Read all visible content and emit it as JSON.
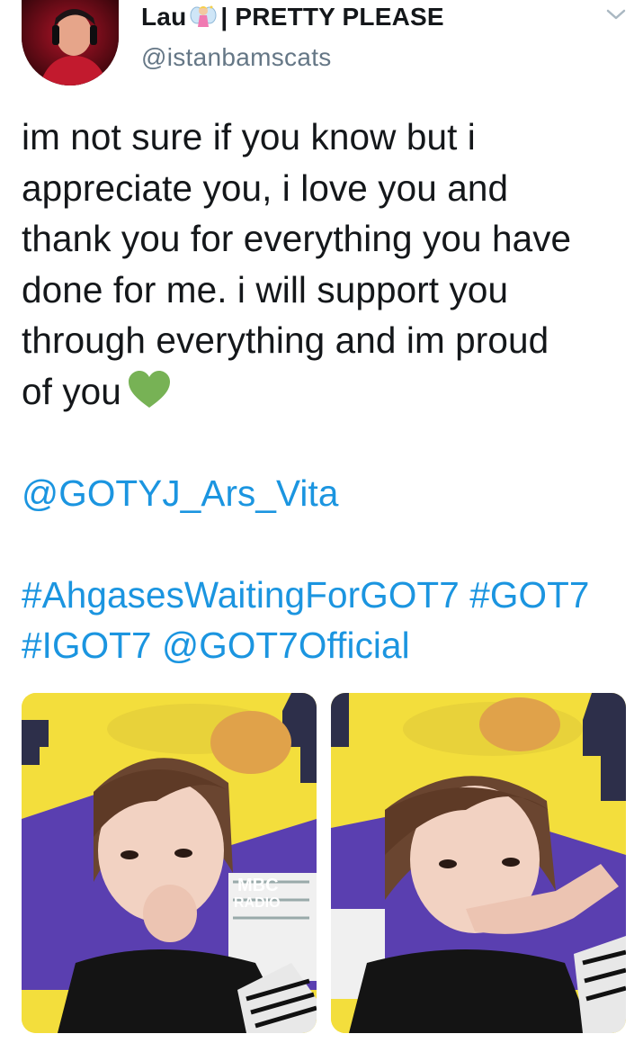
{
  "user": {
    "display_name_prefix": "Lau",
    "display_name_suffix": "| PRETTY PLEASE",
    "handle": "@istanbamscats"
  },
  "tweet": {
    "lines": [
      "im not sure if you know but i",
      "appreciate you, i love you and",
      "thank you for everything you have",
      "done for me. i will support you",
      "through everything and im proud",
      "of you"
    ],
    "mention_line": "@GOTYJ_Ars_Vita",
    "hashtags_line1": "#AhgasesWaitingForGOT7 #GOT7",
    "hashtag_igot7": "#IGOT7",
    "mention_official": "@GOT7Official"
  },
  "media": {
    "photo1_sign_text": [
      "MBC",
      "RADIO"
    ]
  },
  "colors": {
    "link": "#1b95e0",
    "text": "#14171a",
    "secondary": "#657786",
    "heart": "#77b255"
  },
  "icons": [
    "fairy-emoji-icon",
    "chevron-down-icon",
    "green-heart-icon"
  ]
}
